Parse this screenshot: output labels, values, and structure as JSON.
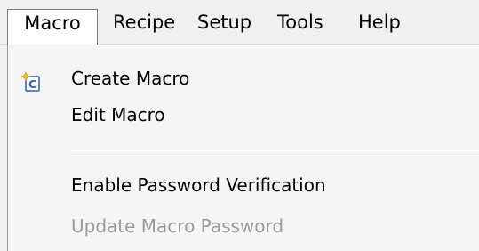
{
  "menubar": {
    "items": [
      {
        "label": "Macro"
      },
      {
        "label": "Recipe"
      },
      {
        "label": "Setup"
      },
      {
        "label": "Tools"
      },
      {
        "label": "Help"
      }
    ]
  },
  "dropdown": {
    "items": [
      {
        "label": "Create Macro",
        "icon": "create-macro-icon",
        "enabled": true
      },
      {
        "label": "Edit Macro",
        "enabled": true
      },
      {
        "label": "Enable Password Verification",
        "enabled": true
      },
      {
        "label": "Update Macro Password",
        "enabled": false
      }
    ]
  }
}
